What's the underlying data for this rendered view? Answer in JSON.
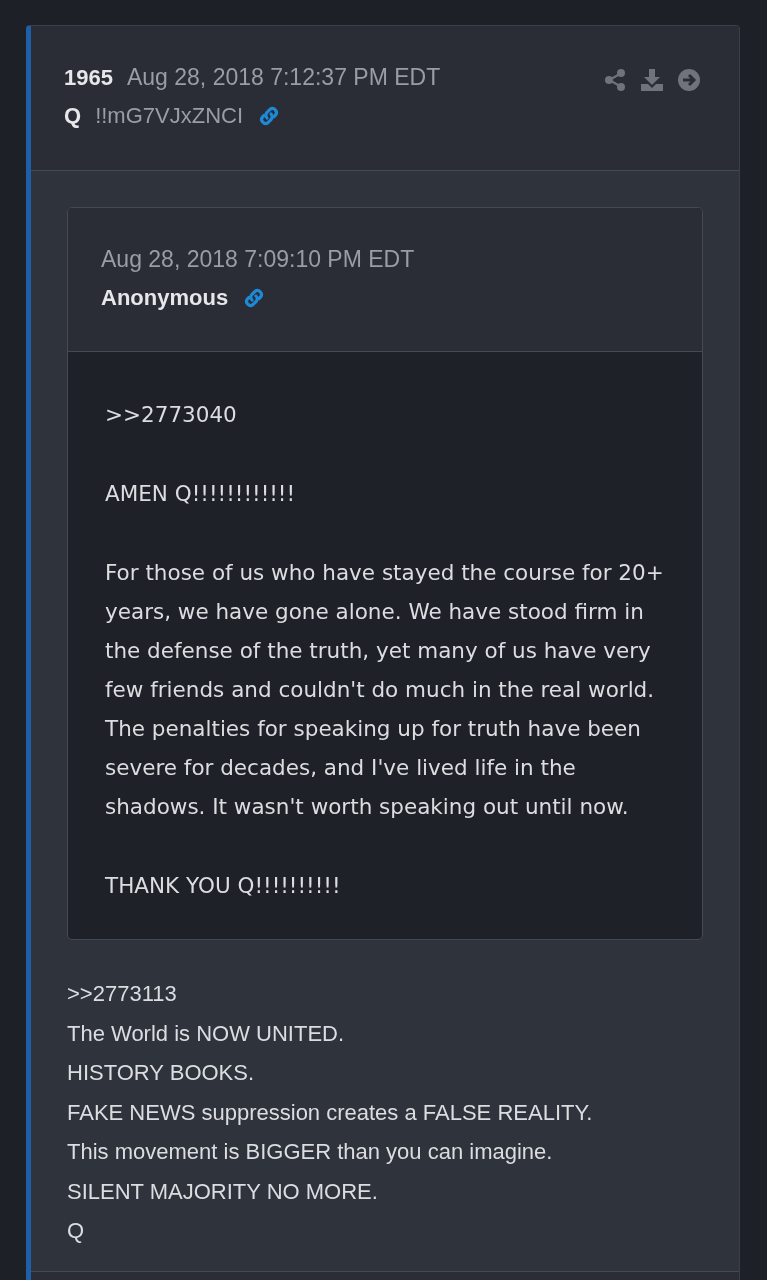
{
  "post": {
    "number": "1965",
    "date": "Aug 28, 2018 7:12:37 PM EDT",
    "author": "Q",
    "tripcode": "!!mG7VJxZNCI"
  },
  "quote": {
    "date": "Aug 28, 2018 7:09:10 PM EDT",
    "author": "Anonymous",
    "paragraphs": [
      ">>2773040",
      "AMEN Q!!!!!!!!!!!!",
      "For those of us who have stayed the course for 20+ years, we have gone alone. We have stood firm in the defense of the truth, yet many of us have very few friends and couldn't do much in the real world. The penalties for speaking up for truth have been severe for decades, and I've lived life in the shadows. It wasn't worth speaking out until now.",
      "THANK YOU Q!!!!!!!!!!"
    ]
  },
  "message": [
    ">>2773113",
    "The World is NOW UNITED.",
    "HISTORY BOOKS.",
    "FAKE NEWS suppression creates a FALSE REALITY.",
    "This movement is BIGGER than you can imagine.",
    "SILENT MAJORITY NO MORE.",
    "Q"
  ]
}
